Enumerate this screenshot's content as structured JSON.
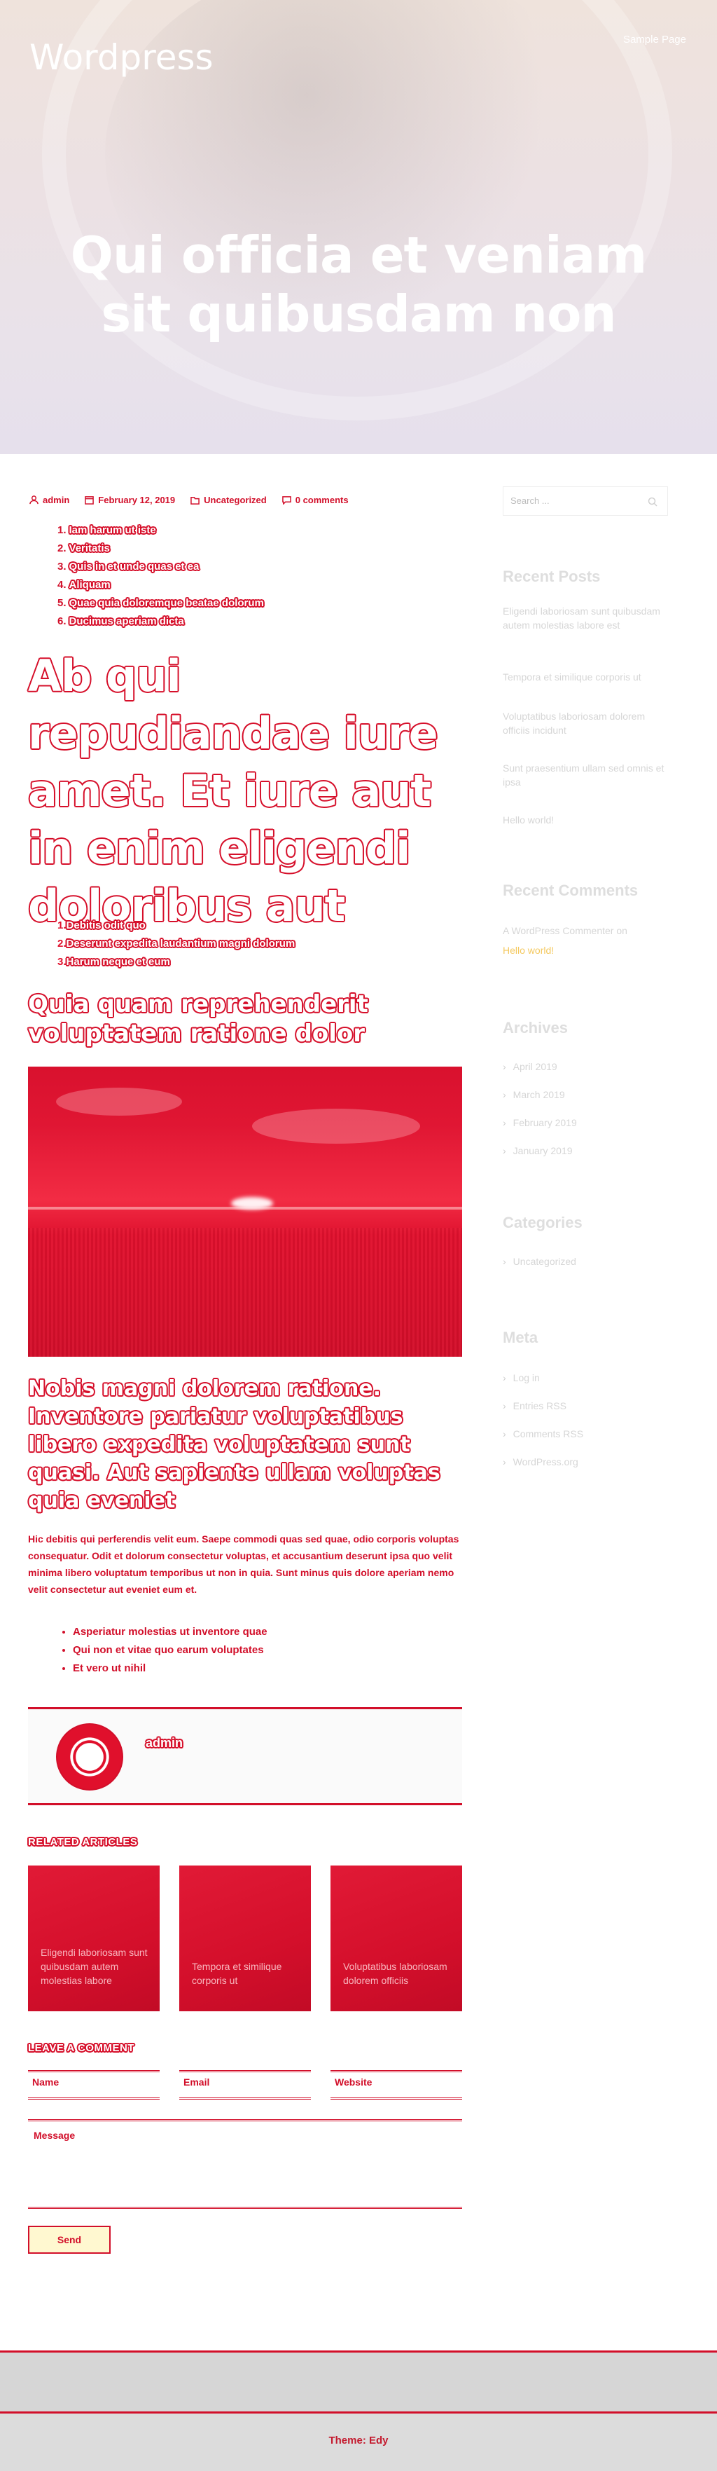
{
  "header": {
    "site_title": "Wordpress",
    "nav_link": "Sample Page",
    "hero_heading": "Qui officia et veniam sit quibusdam non"
  },
  "colors": {
    "accent": "#d20f2a",
    "sidebar_text": "#d6d6d6",
    "comment_link": "#f4c960"
  },
  "post": {
    "meta": {
      "author": "admin",
      "date": "February 12, 2019",
      "category": "Uncategorized",
      "comments": "0 comments"
    },
    "toc": [
      {
        "num": "1.",
        "text": "Iam harum ut iste"
      },
      {
        "num": "2.",
        "text": "Veritatis"
      },
      {
        "num": "3.",
        "text": "Quis in et unde quas et ea"
      },
      {
        "num": "4.",
        "text": "Aliquam"
      },
      {
        "num": "5.",
        "text": "Quae quia doloremque beatae dolorum"
      },
      {
        "num": "6.",
        "text": "Ducimus aperiam dicta"
      }
    ],
    "big_heading": "Ab qui repudiandae iure amet. Et iure aut in enim eligendi doloribus aut",
    "toc2": [
      {
        "num": "1.",
        "text": "Debitis odit quo"
      },
      {
        "num": "2.",
        "text": "Deserunt expedita laudantium magni dolorum"
      },
      {
        "num": "3.",
        "text": "Harum neque et eum"
      }
    ],
    "h3": "Quia quam reprehenderit voluptatem ratione dolor",
    "h3b": "Nobis magni dolorem ratione. Inventore pariatur voluptatibus libero expedita voluptatem sunt quasi. Aut sapiente ullam voluptas quia eveniet",
    "paragraph": "Hic debitis qui perferendis velit eum. Saepe commodi quas sed quae, odio corporis voluptas consequatur. Odit et dolorum consectetur voluptas, et accusantium deserunt ipsa quo velit minima libero voluptatum temporibus ut non in quia. Sunt minus quis dolore aperiam nemo velit consectetur aut eveniet eum et.",
    "bullets": [
      "Asperiatur molestias ut inventore quae",
      "Qui non et vitae quo earum voluptates",
      "Et vero ut nihil"
    ],
    "author_box": {
      "name": "admin"
    }
  },
  "related": {
    "label": "RELATED ARTICLES",
    "cards": [
      {
        "title": "Eligendi laboriosam sunt quibusdam autem molestias labore"
      },
      {
        "title": "Tempora et similique corporis ut"
      },
      {
        "title": "Voluptatibus laboriosam dolorem officiis"
      }
    ]
  },
  "comment_form": {
    "label": "LEAVE A COMMENT",
    "name": "Name",
    "email": "Email",
    "website": "Website",
    "message": "Message",
    "submit": "Send"
  },
  "sidebar": {
    "search_placeholder": "Search ...",
    "recent_posts_title": "Recent Posts",
    "recent_posts": [
      "Eligendi laboriosam sunt quibusdam autem molestias labore est",
      "Tempora et similique corporis ut",
      "Voluptatibus laboriosam dolorem officiis incidunt",
      "Sunt praesentium ullam sed omnis et ipsa",
      "Hello world!"
    ],
    "recent_comments_title": "Recent Comments",
    "comment": {
      "author": "A WordPress Commenter",
      "on": "on",
      "post": "Hello world!"
    },
    "archives_title": "Archives",
    "archives": [
      "April 2019",
      "March 2019",
      "February 2019",
      "January 2019"
    ],
    "categories_title": "Categories",
    "categories": [
      "Uncategorized"
    ],
    "meta_title": "Meta",
    "meta_links": [
      "Log in",
      "Entries RSS",
      "Comments RSS",
      "WordPress.org"
    ]
  },
  "footer": {
    "credit": "Theme: Edy"
  }
}
